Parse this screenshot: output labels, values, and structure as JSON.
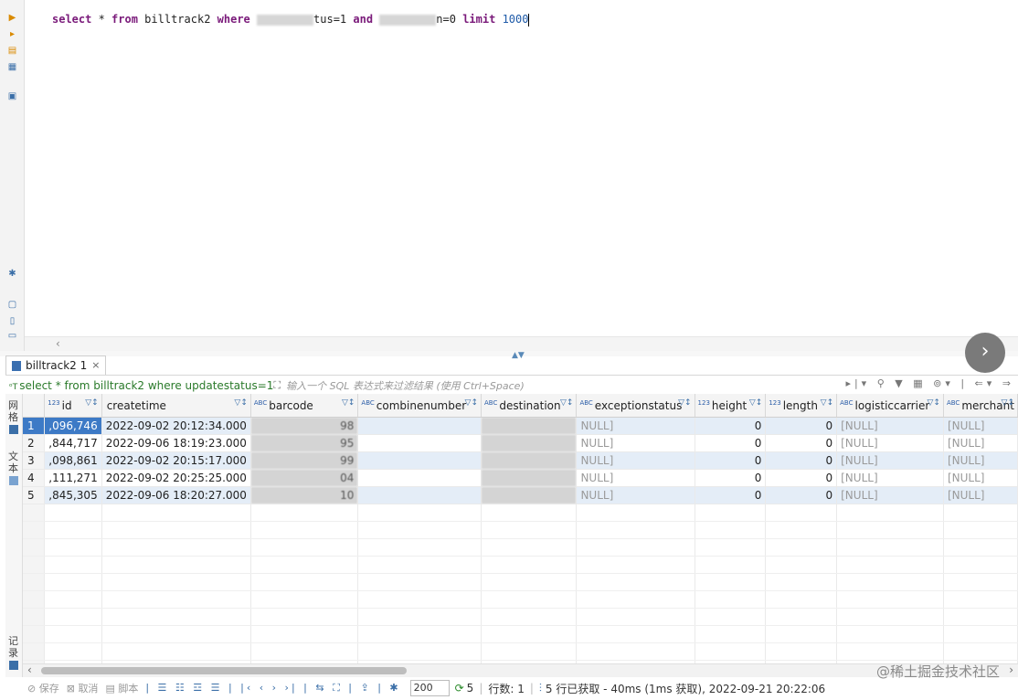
{
  "editor": {
    "kw_select": "select",
    "star": " * ",
    "kw_from": "from",
    "table": " billtrack2 ",
    "kw_where": "where",
    "cond1_tail": "tus=1 ",
    "kw_and": "and",
    "cond2_tail": "n=0 ",
    "kw_limit": "limit",
    "limit_value": "1000"
  },
  "result_tab": {
    "label": "billtrack2 1",
    "close": "×"
  },
  "filter_bar": {
    "sql": "select * from billtrack2 where updatestatus=1 ",
    "placeholder": "输入一个 SQL 表达式来过滤结果 (使用 Ctrl+Space)"
  },
  "side_panel": {
    "grid_label": "网格",
    "text_label": "文本",
    "record_label": "记录"
  },
  "grid": {
    "columns": [
      {
        "type": "123",
        "name": "id"
      },
      {
        "type": "",
        "name": "createtime"
      },
      {
        "type": "ABC",
        "name": "barcode"
      },
      {
        "type": "ABC",
        "name": "combinenumber"
      },
      {
        "type": "ABC",
        "name": "destination"
      },
      {
        "type": "ABC",
        "name": "exceptionstatus"
      },
      {
        "type": "123",
        "name": "height"
      },
      {
        "type": "123",
        "name": "length"
      },
      {
        "type": "ABC",
        "name": "logisticcarrier"
      },
      {
        "type": "ABC",
        "name": "merchant"
      }
    ],
    "rows": [
      {
        "n": "1",
        "id": ",096,746",
        "createtime": "2022-09-02 20:12:34.000",
        "barcode": "98",
        "combinenumber": "",
        "destination": "",
        "exceptionstatus": "NULL]",
        "height": "0",
        "length": "0",
        "logisticcarrier": "[NULL]",
        "merchant": "[NULL]"
      },
      {
        "n": "2",
        "id": ",844,717",
        "createtime": "2022-09-06 18:19:23.000",
        "barcode": "95",
        "combinenumber": "",
        "destination": "",
        "exceptionstatus": "NULL]",
        "height": "0",
        "length": "0",
        "logisticcarrier": "[NULL]",
        "merchant": "[NULL]"
      },
      {
        "n": "3",
        "id": ",098,861",
        "createtime": "2022-09-02 20:15:17.000",
        "barcode": "99",
        "combinenumber": "",
        "destination": "",
        "exceptionstatus": "NULL]",
        "height": "0",
        "length": "0",
        "logisticcarrier": "[NULL]",
        "merchant": "[NULL]"
      },
      {
        "n": "4",
        "id": ",111,271",
        "createtime": "2022-09-02 20:25:25.000",
        "barcode": "04",
        "combinenumber": "",
        "destination": "",
        "exceptionstatus": "NULL]",
        "height": "0",
        "length": "0",
        "logisticcarrier": "[NULL]",
        "merchant": "[NULL]"
      },
      {
        "n": "5",
        "id": ",845,305",
        "createtime": "2022-09-06 18:20:27.000",
        "barcode": "10",
        "combinenumber": "",
        "destination": "",
        "exceptionstatus": "NULL]",
        "height": "0",
        "length": "0",
        "logisticcarrier": "[NULL]",
        "merchant": "[NULL]"
      }
    ]
  },
  "statusbar": {
    "save": "保存",
    "cancel": "取消",
    "script": "脚本",
    "fetch_size": "200",
    "fetched_count": "5",
    "rows_label": "行数: 1",
    "summary": "5 行已获取 - 40ms (1ms 获取), 2022-09-21 20:22:06"
  },
  "watermark": "@稀土掘金技术社区",
  "colors": {
    "selection": "#3d7ac6",
    "alt_row": "#e4edf7",
    "keyword": "#7a1a7a",
    "filter_sql": "#2a7a2a"
  }
}
